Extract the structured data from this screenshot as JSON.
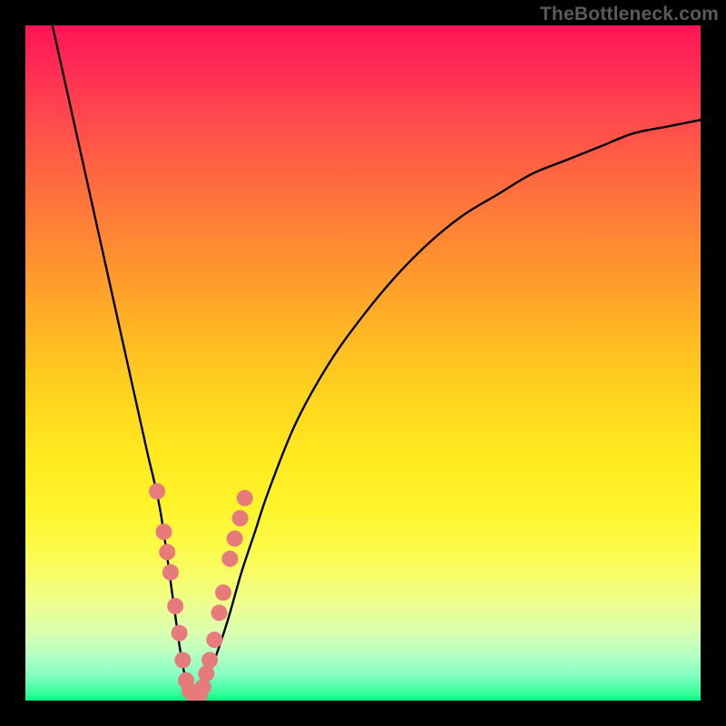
{
  "watermark": {
    "text": "TheBottleneck.com"
  },
  "colors": {
    "frame": "#000000",
    "curve": "#000000",
    "marker": "#e77b7b",
    "gradient_top": "#ff1455",
    "gradient_bottom": "#00f884"
  },
  "chart_data": {
    "type": "line",
    "title": "",
    "xlabel": "",
    "ylabel": "",
    "xlim": [
      0,
      100
    ],
    "ylim": [
      0,
      100
    ],
    "grid": false,
    "legend": false,
    "series": [
      {
        "name": "bottleneck-curve",
        "x": [
          4,
          6,
          8,
          10,
          12,
          14,
          16,
          18,
          20,
          22,
          23,
          24,
          25,
          26,
          28,
          30,
          32,
          34,
          36,
          40,
          45,
          50,
          55,
          60,
          65,
          70,
          75,
          80,
          85,
          90,
          95,
          100
        ],
        "y": [
          100,
          91,
          82,
          73,
          64,
          55,
          46,
          37,
          28,
          14,
          7,
          2,
          0,
          1,
          6,
          12,
          19,
          25,
          31,
          41,
          50,
          57,
          63,
          68,
          72,
          75,
          78,
          80,
          82,
          84,
          85,
          86
        ]
      }
    ],
    "markers": {
      "name": "highlighted-points",
      "x": [
        19.5,
        20.5,
        21.0,
        21.5,
        22.2,
        22.8,
        23.3,
        23.8,
        24.3,
        25.0,
        25.8,
        26.3,
        26.8,
        27.3,
        28.0,
        28.7,
        29.3,
        30.3,
        31.0,
        31.8,
        32.5
      ],
      "y": [
        31,
        25,
        22,
        19,
        14,
        10,
        6,
        3,
        1.5,
        0.5,
        0.8,
        2,
        4,
        6,
        9,
        13,
        16,
        21,
        24,
        27,
        30
      ]
    },
    "notes": "V-shaped bottleneck curve over vertical red→green gradient. Minimum (0%) around x≈25; left branch rises to 100% at x≈4; right branch asymptotes near 86% at x=100. Salmon circular markers cluster along the curve below y≈31. No axis ticks, labels, or legend are visible."
  }
}
